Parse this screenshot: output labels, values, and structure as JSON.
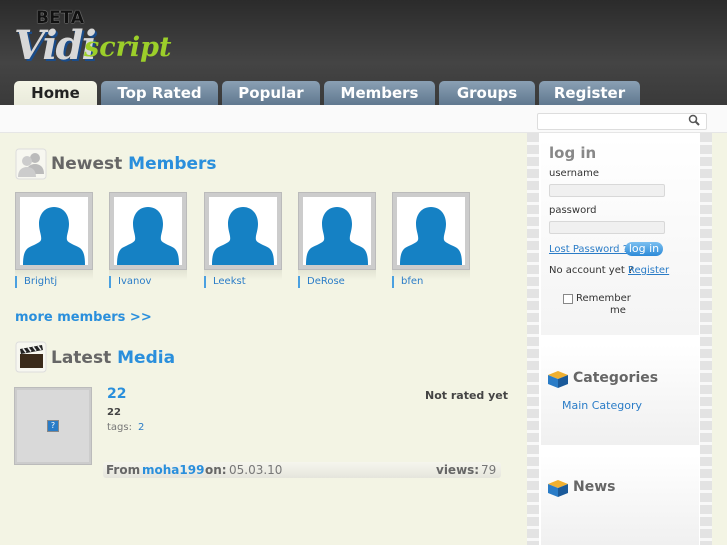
{
  "logo": {
    "beta": "BETA",
    "vidi": "Vidi",
    "script": "script"
  },
  "tabs": [
    {
      "label": "Home",
      "active": true
    },
    {
      "label": "Top Rated"
    },
    {
      "label": "Popular"
    },
    {
      "label": "Members"
    },
    {
      "label": "Groups"
    },
    {
      "label": "Register"
    }
  ],
  "search": {
    "placeholder": ""
  },
  "newest_members": {
    "title_prefix": "Newest",
    "title_highlight": "Members",
    "members": [
      {
        "name": "Brightj"
      },
      {
        "name": "Ivanov"
      },
      {
        "name": "Leekst"
      },
      {
        "name": "DeRose"
      },
      {
        "name": "bfen"
      }
    ],
    "more_link": "more members >>"
  },
  "latest_media": {
    "title_prefix": "Latest",
    "title_highlight": "Media",
    "item": {
      "title": "22",
      "description": "22",
      "rating": "Not rated yet",
      "tags_label": "tags:",
      "tags": [
        "2"
      ],
      "from_label": "From",
      "author": "moha199",
      "on_label": "on:",
      "date": "05.03.10",
      "views_label": "views:",
      "views": "79"
    }
  },
  "login": {
    "title": "log in",
    "username_label": "username",
    "password_label": "password",
    "lost_password": "Lost Password ?",
    "login_button": "log in",
    "no_account": "No account yet ?",
    "register_link": "Register",
    "remember_line1": "Remember",
    "remember_line2": "me"
  },
  "categories": {
    "title": "Categories",
    "items": [
      "Main Category"
    ]
  },
  "news": {
    "title": "News"
  },
  "colors": {
    "accent": "#2a8fdc",
    "tab": "#6f879d",
    "page_bg": "#f3f4e4"
  }
}
